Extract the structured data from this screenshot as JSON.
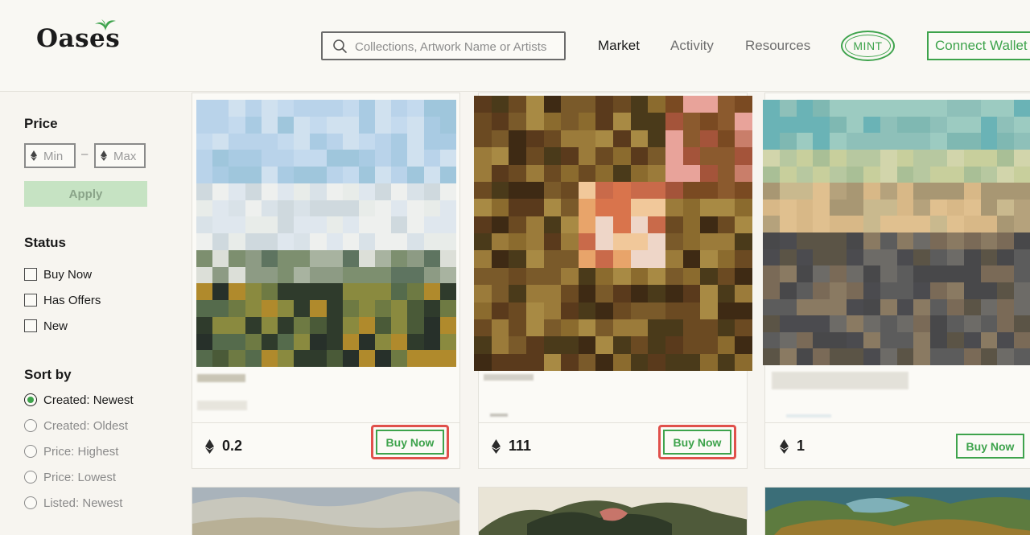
{
  "header": {
    "logo": "Oases",
    "search_placeholder": "Collections, Artwork Name or Artists",
    "nav": [
      {
        "label": "Market",
        "active": true
      },
      {
        "label": "Activity",
        "active": false
      },
      {
        "label": "Resources",
        "active": false
      }
    ],
    "mint_label": "MINT",
    "connect_label": "Connect Wallet"
  },
  "sidebar": {
    "price_title": "Price",
    "min_placeholder": "Min",
    "max_placeholder": "Max",
    "dash": "–",
    "apply_label": "Apply",
    "status_title": "Status",
    "status_options": [
      "Buy Now",
      "Has Offers",
      "New"
    ],
    "sort_title": "Sort by",
    "sort_options": [
      {
        "label": "Created: Newest",
        "selected": true
      },
      {
        "label": "Created: Oldest",
        "selected": false
      },
      {
        "label": "Price: Highest",
        "selected": false
      },
      {
        "label": "Price: Lowest",
        "selected": false
      },
      {
        "label": "Listed: Newest",
        "selected": false
      }
    ]
  },
  "cards": [
    {
      "price": "0.2",
      "buy_label": "Buy Now",
      "highlighted": true
    },
    {
      "price": "111",
      "buy_label": "Buy Now",
      "highlighted": true
    },
    {
      "price": "1",
      "buy_label": "Buy Now",
      "highlighted": false
    }
  ],
  "colors": {
    "accent": "#3ea34c",
    "highlight": "#e0504b",
    "apply_bg": "#c6e3c3",
    "page_bg": "#f7f5f0"
  },
  "icons": {
    "search": "search-icon",
    "eth": "ethereum-icon",
    "logo_leaf": "palm-leaf-icon"
  }
}
